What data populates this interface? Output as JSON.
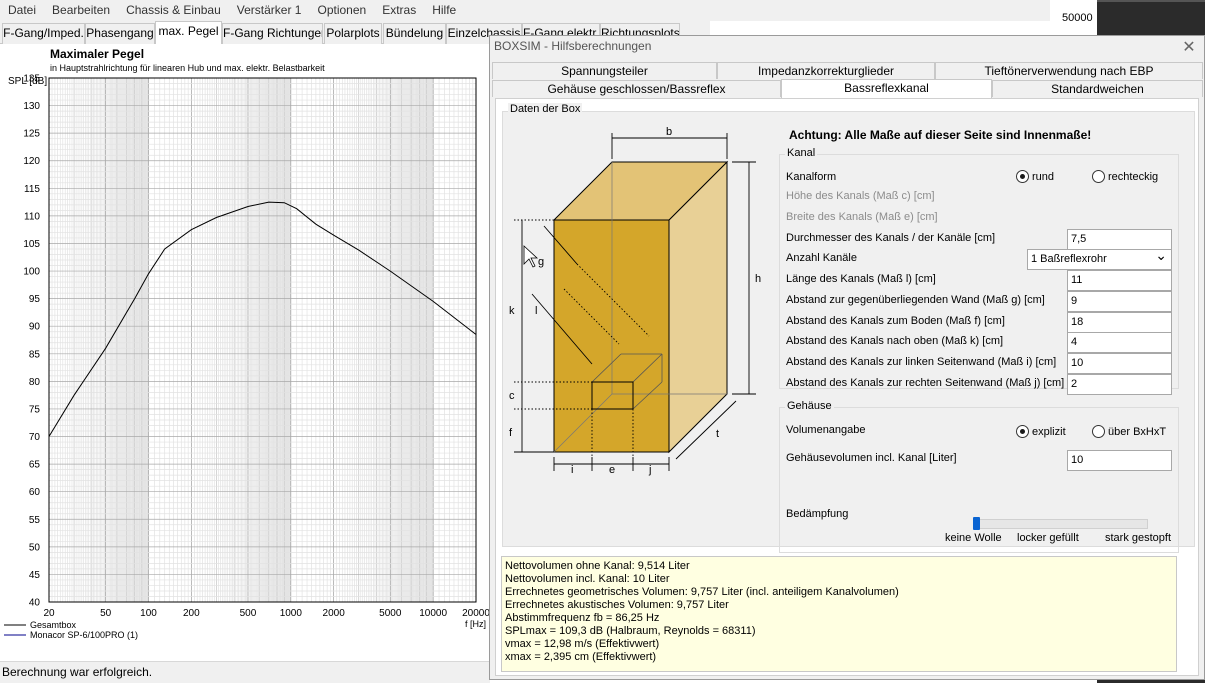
{
  "menu": [
    "Datei",
    "Bearbeiten",
    "Chassis & Einbau",
    "Verstärker 1",
    "Optionen",
    "Extras",
    "Hilfe"
  ],
  "main_tabs": [
    "F-Gang/Imped.",
    "Phasengang",
    "max. Pegel",
    "F-Gang Richtungen",
    "Polarplots",
    "Bündelung",
    "Einzelchassis",
    "F-Gang elektr.",
    "Richtungsplots"
  ],
  "right_strip_value": "50000",
  "chart": {
    "title": "Maximaler Pegel",
    "subtitle": "in Hauptstrahlrichtung für linearen Hub und max. elektr. Belastbarkeit",
    "ylabel": "SPL [dB]",
    "xlabel": "f [Hz]",
    "legend": [
      "Gesamtbox",
      "Monacor SP-6/100PRO (1)"
    ]
  },
  "chart_data": {
    "type": "line",
    "title": "Maximaler Pegel",
    "subtitle": "in Hauptstrahlrichtung für linearen Hub und max. elektr. Belastbarkeit",
    "xlabel": "f [Hz]",
    "ylabel": "SPL [dB]",
    "xscale": "log",
    "xlim": [
      20,
      20000
    ],
    "ylim": [
      40,
      135
    ],
    "yticks": [
      40,
      45,
      50,
      55,
      60,
      65,
      70,
      75,
      80,
      85,
      90,
      95,
      100,
      105,
      110,
      115,
      120,
      125,
      130,
      135
    ],
    "xticks": [
      20,
      50,
      100,
      200,
      500,
      1000,
      2000,
      5000,
      10000,
      20000
    ],
    "xtick_labels": [
      "20",
      "50",
      "100",
      "200",
      "500",
      "1000",
      "2000",
      "5000",
      "10000",
      "20000"
    ],
    "grid": true,
    "legend_position": "bottom-left",
    "series": [
      {
        "name": "Gesamtbox",
        "color": "#000000",
        "x": [
          20,
          30,
          50,
          80,
          100,
          130,
          200,
          300,
          500,
          700,
          900,
          1100,
          1500,
          2000,
          3000,
          5000,
          10000,
          20000
        ],
        "y": [
          70,
          77.5,
          86,
          95,
          99.5,
          104,
          107.5,
          109.7,
          111.7,
          112.5,
          112.4,
          111.3,
          108.5,
          106.5,
          103.8,
          100,
          94.5,
          88.5
        ]
      },
      {
        "name": "Monacor SP-6/100PRO (1)",
        "color": "#00008b",
        "x": [],
        "y": []
      }
    ]
  },
  "status": "Berechnung war erfolgreich.",
  "dialog": {
    "title": "BOXSIM - Hilfsberechnungen",
    "tabs_row1": [
      "Spannungsteiler",
      "Impedanzkorrekturglieder",
      "Tieftönerverwendung nach EBP"
    ],
    "tabs_row2": [
      "Gehäuse geschlossen/Bassreflex",
      "Bassreflexkanal",
      "Standardweichen"
    ],
    "group_title": "Daten der Box",
    "warning": "Achtung: Alle Maße auf dieser Seite sind Innenmaße!",
    "diagram_labels": {
      "b": "b",
      "h": "h",
      "t": "t",
      "k": "k",
      "g": "g",
      "l": "l",
      "c": "c",
      "f": "f",
      "i": "i",
      "e": "e",
      "j": "j"
    },
    "kanal": {
      "title": "Kanal",
      "form_label": "Kanalform",
      "form_options": [
        "rund",
        "rechteckig"
      ],
      "form_selected": "rund",
      "rows": [
        {
          "label": "Höhe des Kanals (Maß c) [cm]",
          "value": "",
          "disabled": true
        },
        {
          "label": "Breite des Kanals (Maß e) [cm]",
          "value": "",
          "disabled": true
        },
        {
          "label": "Durchmesser des Kanals / der Kanäle [cm]",
          "value": "7,5",
          "disabled": false
        },
        {
          "label": "Anzahl Kanäle",
          "value": "1 Baßreflexrohr",
          "disabled": false,
          "select": true
        },
        {
          "label": "Länge des Kanals (Maß l) [cm]",
          "value": "11",
          "disabled": false
        },
        {
          "label": "Abstand zur gegenüberliegenden Wand (Maß g) [cm]",
          "value": "9",
          "disabled": false
        },
        {
          "label": "Abstand des Kanals zum Boden (Maß f) [cm]",
          "value": "18",
          "disabled": false
        },
        {
          "label": "Abstand des Kanals nach oben (Maß k) [cm]",
          "value": "4",
          "disabled": false
        },
        {
          "label": "Abstand des Kanals zur linken Seitenwand (Maß i) [cm]",
          "value": "10",
          "disabled": false
        },
        {
          "label": "Abstand des Kanals zur rechten Seitenwand (Maß j) [cm]",
          "value": "2",
          "disabled": false
        }
      ]
    },
    "gehaeuse": {
      "title": "Gehäuse",
      "vol_label": "Volumenangabe",
      "vol_options": [
        "explizit",
        "über BxHxT"
      ],
      "vol_selected": "explizit",
      "volume_label": "Gehäusevolumen incl. Kanal [Liter]",
      "volume_value": "10",
      "damping_label": "Bedämpfung",
      "damping_ticks": [
        "keine Wolle",
        "locker gefüllt",
        "stark gestopft"
      ],
      "damping_level": 0
    },
    "results": [
      "Nettovolumen ohne Kanal: 9,514 Liter",
      "Nettovolumen incl. Kanal: 10 Liter",
      "Errechnetes geometrisches Volumen: 9,757 Liter (incl. anteiligem Kanalvolumen)",
      "Errechnetes akustisches Volumen: 9,757 Liter",
      "Abstimmfrequenz fb = 86,25 Hz",
      "SPLmax = 109,3 dB (Halbraum, Reynolds = 68311)",
      "vmax = 12,98 m/s (Effektivwert)",
      "xmax = 2,395 cm (Effektivwert)"
    ]
  },
  "colors": {
    "box_front": "#d4a62a",
    "box_side": "#e8d096",
    "box_top": "#e3c376",
    "result_bg": "#ffffe1",
    "slider": "#0a64d2"
  }
}
